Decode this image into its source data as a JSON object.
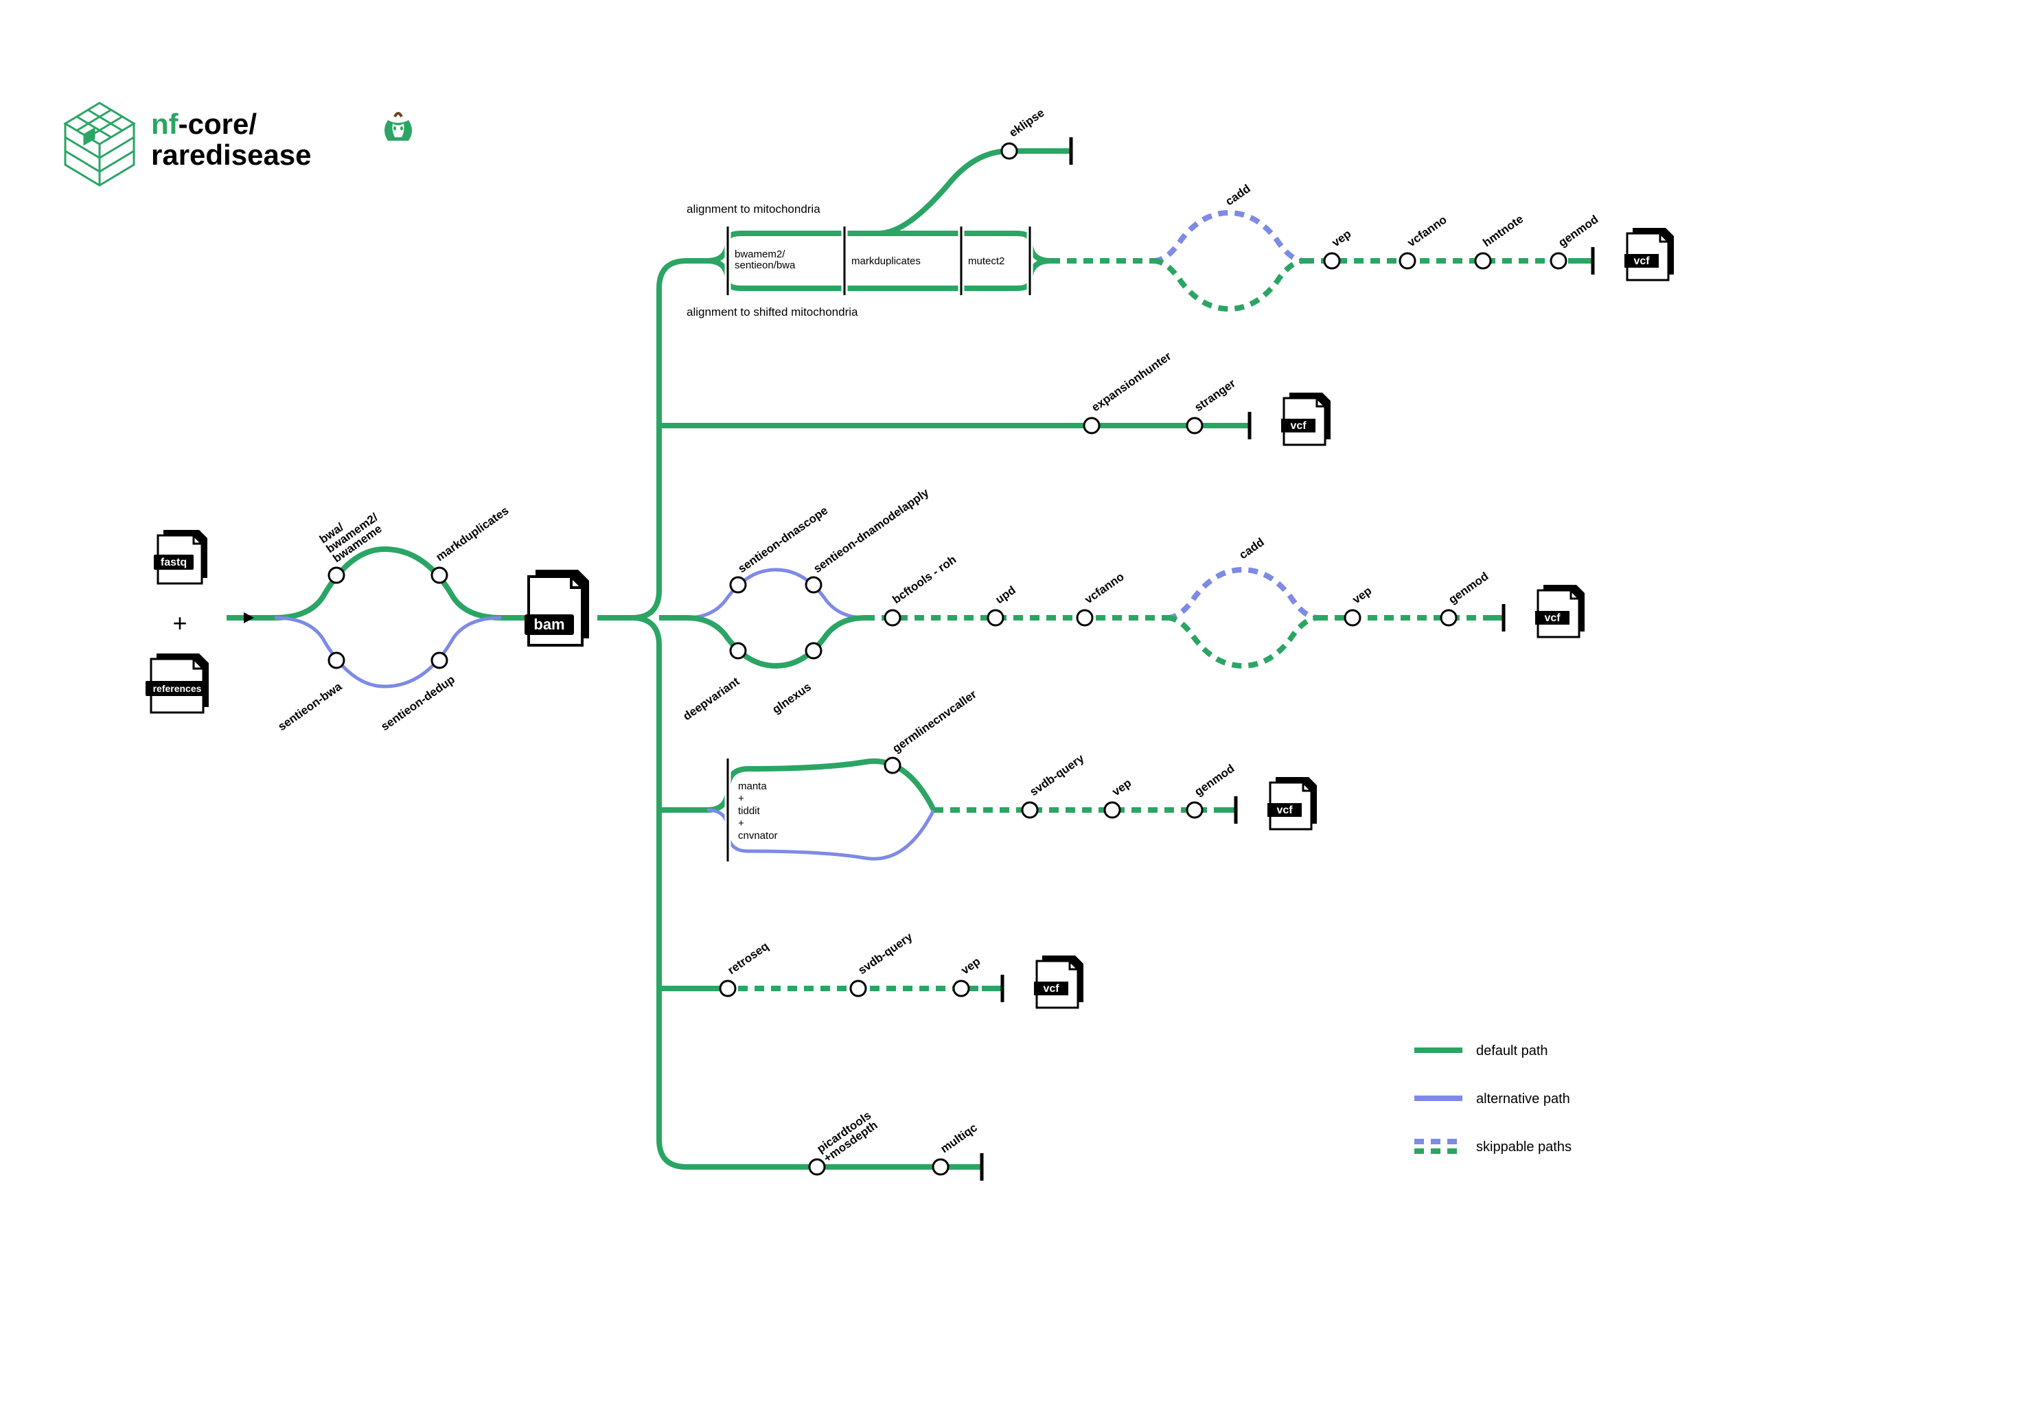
{
  "logo": {
    "prefix": "nf",
    "sep": "-core/",
    "line2": "raredisease"
  },
  "inputs": {
    "fastq": "fastq",
    "references": "references",
    "plus": "+"
  },
  "bam": "bam",
  "labels": {
    "bwa_top": "bwa/\nbwamem2/\nbwameme",
    "markdup": "markduplicates",
    "sentieon_bwa": "sentieon-bwa",
    "sentieon_dedup": "sentieon-dedup",
    "align_mito": "alignment to mitochondria",
    "align_mito_shift": "alignment to shifted mitochondria",
    "mito_aligner": "bwamem2/\nsentieon/bwa",
    "mito_markdup": "markduplicates",
    "mutect2": "mutect2",
    "eklipse": "eklipse",
    "cadd": "cadd",
    "vep": "vep",
    "vcfanno": "vcfanno",
    "hmtnote": "hmtnote",
    "genmod": "genmod",
    "expansionhunter": "expansionhunter",
    "stranger": "stranger",
    "sentieon_dnascope": "sentieon-dnascope",
    "sentieon_dnamodel": "sentieon-dnamodelapply",
    "deepvariant": "deepvariant",
    "glnexus": "glnexus",
    "bcftools_roh": "bcftools - roh",
    "upd": "upd",
    "germlinecnv": "germlinecnvcaller",
    "manta_tiddit": "manta\n+\ntiddit\n+\ncnvnator",
    "svdb_query": "svdb-query",
    "retroseq": "retroseq",
    "picard": "picardtools\n+mosdepth",
    "multiqc": "multiqc"
  },
  "vcf": "vcf",
  "legend": {
    "default": "default path",
    "alt": "alternative path",
    "skip": "skippable paths"
  }
}
